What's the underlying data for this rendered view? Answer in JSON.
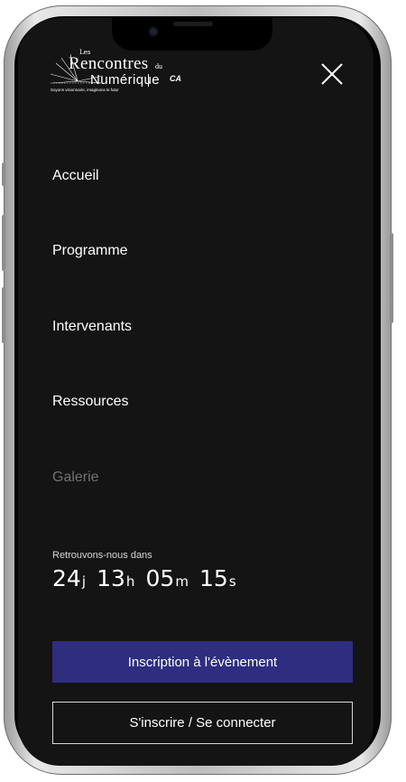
{
  "logo": {
    "line_les": "Les",
    "line_rencontres": "Rencontres",
    "line_du": "du",
    "line_numerique": "Numérique",
    "brand_mark": "CA",
    "tagline": "Soyons visionnaire, imaginons le futur"
  },
  "icons": {
    "close": "close-icon"
  },
  "nav": {
    "items": [
      {
        "label": "Accueil",
        "state": "default"
      },
      {
        "label": "Programme",
        "state": "default"
      },
      {
        "label": "Intervenants",
        "state": "default"
      },
      {
        "label": "Ressources",
        "state": "default"
      },
      {
        "label": "Galerie",
        "state": "muted"
      }
    ]
  },
  "countdown": {
    "label": "Retrouvons-nous dans",
    "days": "24",
    "days_unit": "j",
    "hours": "13",
    "hours_unit": "h",
    "minutes": "05",
    "minutes_unit": "m",
    "seconds": "15",
    "seconds_unit": "s"
  },
  "actions": {
    "register_event_label": "Inscription à l'évènement",
    "login_label": "S'inscrire / Se connecter"
  },
  "colors": {
    "background": "#141414",
    "primary_button": "#2e2d80",
    "text": "#ffffff",
    "muted_text": "#727272"
  }
}
